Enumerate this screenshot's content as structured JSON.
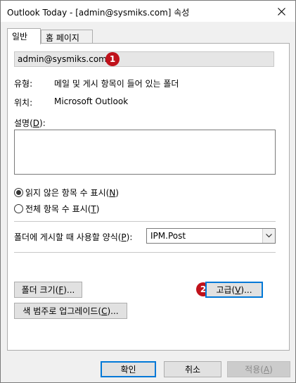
{
  "window": {
    "title": "Outlook Today - [admin@sysmiks.com] 속성"
  },
  "tabs": [
    {
      "label": "일반",
      "active": true
    },
    {
      "label": "홈 페이지",
      "active": false
    }
  ],
  "general": {
    "folder_name": "admin@sysmiks.com",
    "type_label": "유형:",
    "type_value": "메일 및 게시 항목이 들어 있는 폴더",
    "location_label": "위치:",
    "location_value": "Microsoft Outlook",
    "description_label_pre": "설명(",
    "description_label_key": "D",
    "description_label_post": "):",
    "description_value": "",
    "radio_unread": {
      "pre": "읽지 않은 항목 수 표시(",
      "key": "N",
      "post": ")",
      "selected": true
    },
    "radio_total": {
      "pre": "전체 항목 수 표시(",
      "key": "T",
      "post": ")",
      "selected": false
    },
    "form_label_pre": "폴더에 게시할 때 사용할 양식(",
    "form_label_key": "P",
    "form_label_post": "):",
    "form_value": "IPM.Post",
    "folder_size_btn": {
      "pre": "폴더 크기(",
      "key": "F",
      "post": ")..."
    },
    "advanced_btn": {
      "pre": "고급(",
      "key": "V",
      "post": ")..."
    },
    "upgrade_btn": {
      "pre": "색 범주로 업그레이드(",
      "key": "C",
      "post": ")..."
    }
  },
  "badges": {
    "one": "1",
    "two": "2"
  },
  "footer": {
    "ok": "확인",
    "cancel": "취소",
    "apply_pre": "적용(",
    "apply_key": "A",
    "apply_post": ")"
  },
  "colors": {
    "badge": "#c0121b",
    "focus": "#0078d7"
  }
}
